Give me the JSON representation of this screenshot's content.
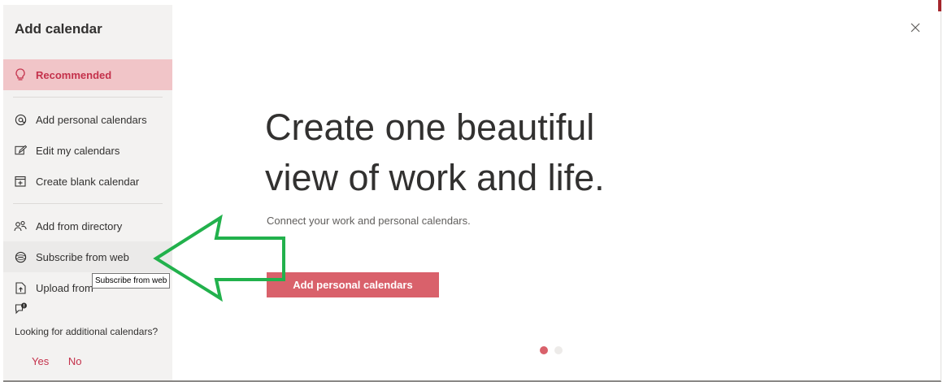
{
  "sidebar": {
    "title": "Add calendar",
    "items": [
      {
        "label": "Recommended",
        "icon": "lightbulb-icon"
      },
      {
        "label": "Add personal calendars",
        "icon": "at-icon"
      },
      {
        "label": "Edit my calendars",
        "icon": "edit-icon"
      },
      {
        "label": "Create blank calendar",
        "icon": "calendar-add-icon"
      },
      {
        "label": "Add from directory",
        "icon": "people-icon"
      },
      {
        "label": "Subscribe from web",
        "icon": "globe-icon"
      },
      {
        "label": "Upload from",
        "icon": "upload-icon"
      }
    ],
    "feedback": {
      "text": "Looking for additional calendars?",
      "yes": "Yes",
      "no": "No"
    }
  },
  "tooltip": "Subscribe from web",
  "main": {
    "title_line1": "Create one beautiful",
    "title_line2": "view of work and life.",
    "subtitle": "Connect your work and personal calendars.",
    "button": "Add personal calendars"
  },
  "colors": {
    "accent": "#c4314b",
    "button": "#d9616b",
    "selected_bg": "#f1c5c8",
    "arrow": "#22b14c"
  },
  "carousel": {
    "pages": 2,
    "active": 1
  }
}
